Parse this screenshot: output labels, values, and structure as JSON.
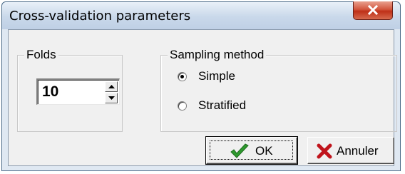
{
  "window": {
    "title": "Cross-validation parameters"
  },
  "folds": {
    "group_label": "Folds",
    "value": "10"
  },
  "sampling": {
    "group_label": "Sampling method",
    "options": [
      {
        "label": "Simple",
        "selected": true
      },
      {
        "label": "Stratified",
        "selected": false
      }
    ]
  },
  "buttons": {
    "ok_label": "OK",
    "cancel_label": "Annuler"
  },
  "icons": {
    "close": "close-icon",
    "ok": "green-checkmark-icon",
    "cancel": "red-x-icon",
    "spin_up": "up-arrow-icon",
    "spin_down": "down-arrow-icon"
  },
  "colors": {
    "ok_check": "#2e9a2e",
    "cancel_x": "#c0141c",
    "close_button": "#c8442a"
  }
}
